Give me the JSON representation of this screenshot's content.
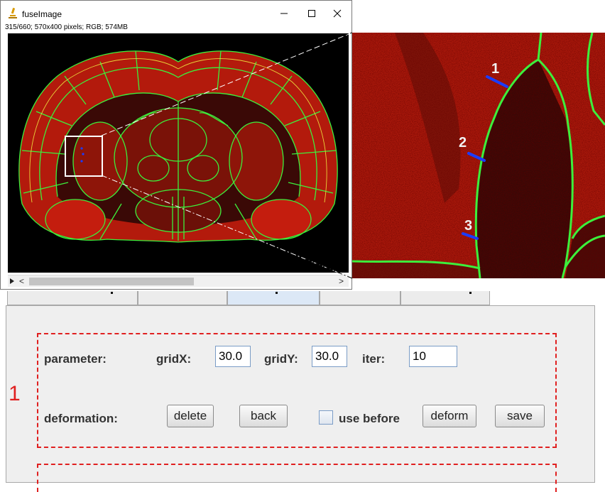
{
  "window": {
    "title": "fuseImage",
    "status": "315/660; 570x400 pixels; RGB; 574MB",
    "controls": {
      "minimize": "–",
      "maximize": "☐",
      "close": "✕"
    },
    "scroll": {
      "left": "<",
      "right": ">"
    }
  },
  "zoom": {
    "landmarks": [
      "1",
      "2",
      "3"
    ]
  },
  "panel": {
    "section_number": "1",
    "parameter_label": "parameter:",
    "gridx_label": "gridX:",
    "gridx_value": "30.0",
    "gridy_label": "gridY:",
    "gridy_value": "30.0",
    "iter_label": "iter:",
    "iter_value": "10",
    "deformation_label": "deformation:",
    "delete_label": "delete",
    "back_label": "back",
    "use_before_label": "use before",
    "deform_label": "deform",
    "save_label": "save"
  },
  "colors": {
    "tissue": "#b31a0c",
    "outline": "#3cf03c",
    "highlight": "#e02020",
    "landmark": "#1a3cff"
  }
}
